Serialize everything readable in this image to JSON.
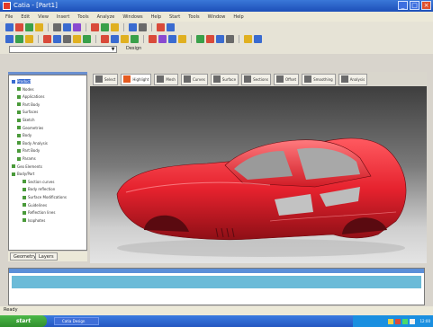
{
  "window": {
    "title": "Catia - [Part1]",
    "btn_min": "_",
    "btn_max": "□",
    "btn_close": "×"
  },
  "menu": [
    "File",
    "Edit",
    "View",
    "Insert",
    "Tools",
    "Analyze",
    "Windows",
    "Help",
    "Start",
    "Tools",
    "Window",
    "Help"
  ],
  "combo": {
    "value": "",
    "label": "Design"
  },
  "tree": {
    "items": [
      {
        "label": "Product",
        "depth": 0
      },
      {
        "label": "Nodes",
        "depth": 1
      },
      {
        "label": "Applications",
        "depth": 1
      },
      {
        "label": "Part Body",
        "depth": 1
      },
      {
        "label": "Surfaces",
        "depth": 1
      },
      {
        "label": "Sketch",
        "depth": 1
      },
      {
        "label": "Geometries",
        "depth": 1
      },
      {
        "label": "Body",
        "depth": 1
      },
      {
        "label": "Body Analysis",
        "depth": 1
      },
      {
        "label": "Part Body",
        "depth": 1
      },
      {
        "label": "Params",
        "depth": 1
      },
      {
        "label": "Geo Elements",
        "depth": 0
      },
      {
        "label": "Body/Part",
        "depth": 0
      },
      {
        "label": "Section curves",
        "depth": 2
      },
      {
        "label": "Body reflection",
        "depth": 2
      },
      {
        "label": "Surface Modifications",
        "depth": 2
      },
      {
        "label": "Guidelines",
        "depth": 2
      },
      {
        "label": "Reflection lines",
        "depth": 2
      },
      {
        "label": "Isophotes",
        "depth": 2
      }
    ],
    "tabs": [
      "Geometry",
      "Layers"
    ]
  },
  "view_tabs": [
    "Select",
    "Highlight",
    "Mesh",
    "Curves",
    "Surface",
    "Sections",
    "Offset",
    "Smoothing",
    "Analysis"
  ],
  "status": {
    "text": "Ready"
  },
  "taskbar": {
    "start": "start",
    "item": "Catia Design",
    "clock": "12:00"
  },
  "colors": {
    "car": "#e6222e",
    "accent": "#2456c0"
  }
}
